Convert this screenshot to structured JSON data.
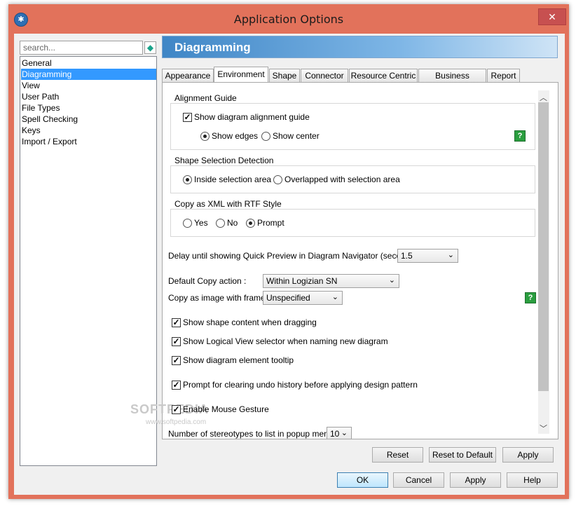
{
  "window": {
    "title": "Application Options"
  },
  "sidebar": {
    "search_placeholder": "search...",
    "items": [
      {
        "label": "General"
      },
      {
        "label": "Diagramming"
      },
      {
        "label": "View"
      },
      {
        "label": "User Path"
      },
      {
        "label": "File Types"
      },
      {
        "label": "Spell Checking"
      },
      {
        "label": "Keys"
      },
      {
        "label": "Import / Export"
      }
    ],
    "selected_index": 1
  },
  "panel": {
    "title": "Diagramming"
  },
  "tabs": [
    {
      "label": "Appearance"
    },
    {
      "label": "Environment"
    },
    {
      "label": "Shape"
    },
    {
      "label": "Connector"
    },
    {
      "label": "Resource Centric"
    },
    {
      "label": "Business Process"
    },
    {
      "label": "Report"
    }
  ],
  "active_tab_index": 1,
  "alignment_guide": {
    "title": "Alignment Guide",
    "show_guide_label": "Show diagram alignment guide",
    "show_guide_checked": true,
    "show_edges_label": "Show edges",
    "show_center_label": "Show center",
    "selected": "Show edges"
  },
  "shape_selection": {
    "title": "Shape Selection Detection",
    "inside_label": "Inside selection area",
    "overlapped_label": "Overlapped with selection area",
    "selected": "Inside selection area"
  },
  "copy_xml": {
    "title": "Copy as XML with RTF Style",
    "yes_label": "Yes",
    "no_label": "No",
    "prompt_label": "Prompt",
    "selected": "Prompt"
  },
  "settings": {
    "delay_label": "Delay until showing Quick Preview in Diagram Navigator (seconds) :",
    "delay_value": "1.5",
    "default_copy_label": "Default Copy action :",
    "default_copy_value": "Within Logizian SN",
    "copy_frame_label": "Copy as image with frame :",
    "copy_frame_value": "Unspecified",
    "show_shape_content": "Show shape content when dragging",
    "show_logical_view": "Show Logical View selector when naming new diagram",
    "show_tooltip": "Show diagram element tooltip",
    "prompt_undo": "Prompt for clearing undo history before applying design pattern",
    "enable_mouse": "Enable Mouse Gesture",
    "stereotypes_label": "Number of stereotypes to list in popup menu :",
    "stereotypes_value": "10"
  },
  "help_glyph": "?",
  "panel_buttons": {
    "reset": "Reset",
    "reset_default": "Reset to Default",
    "apply": "Apply"
  },
  "dialog_buttons": {
    "ok": "OK",
    "cancel": "Cancel",
    "apply": "Apply",
    "help": "Help"
  },
  "watermark": {
    "text": "SOFTPEDIA",
    "url": "www.softpedia.com"
  },
  "colors": {
    "title_bar": "#e2725b",
    "selection": "#3399ff",
    "header_gradient": "#3f86c6",
    "help_icon": "#2a9e3f"
  }
}
